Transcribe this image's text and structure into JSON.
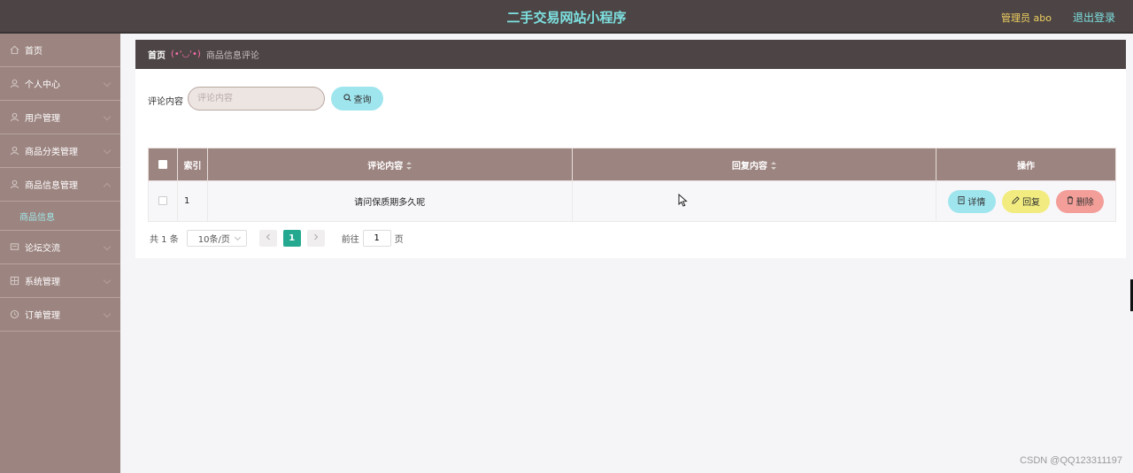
{
  "header": {
    "title": "二手交易网站小程序",
    "user": "管理员 abo",
    "logout": "退出登录"
  },
  "sidebar": {
    "items": [
      {
        "label": "首页",
        "icon": "home-icon"
      },
      {
        "label": "个人中心",
        "icon": "user-icon"
      },
      {
        "label": "用户管理",
        "icon": "users-icon"
      },
      {
        "label": "商品分类管理",
        "icon": "category-icon"
      },
      {
        "label": "商品信息管理",
        "icon": "goods-icon"
      },
      {
        "label": "论坛交流",
        "icon": "forum-icon"
      },
      {
        "label": "系统管理",
        "icon": "settings-icon"
      },
      {
        "label": "订单管理",
        "icon": "order-icon"
      }
    ],
    "subitem": "商品信息"
  },
  "breadcrumb": {
    "home": "首页",
    "face": "(•'◡'•)",
    "current": "商品信息评论"
  },
  "search": {
    "label": "评论内容",
    "placeholder": "评论内容",
    "button": "查询"
  },
  "table": {
    "headers": {
      "index": "索引",
      "comment": "评论内容",
      "reply": "回复内容",
      "ops": "操作"
    },
    "rows": [
      {
        "index": "1",
        "comment": "请问保质期多久呢",
        "reply": ""
      }
    ],
    "actions": {
      "detail": "详情",
      "reply": "回复",
      "delete": "删除"
    }
  },
  "pagination": {
    "total": "共 1 条",
    "page_size": "10条/页",
    "current_page": "1",
    "goto_label": "前往",
    "goto_value": "1",
    "page_suffix": "页"
  },
  "watermark": "CSDN @QQ123311197",
  "colors": {
    "header_bg": "#4d4545",
    "sidebar_bg": "#9c8480",
    "title_color": "#7ee0e0",
    "detail_btn": "#9fe5ee",
    "reply_btn": "#f2ec80",
    "delete_btn": "#f39e98",
    "page_active": "#24a890"
  }
}
